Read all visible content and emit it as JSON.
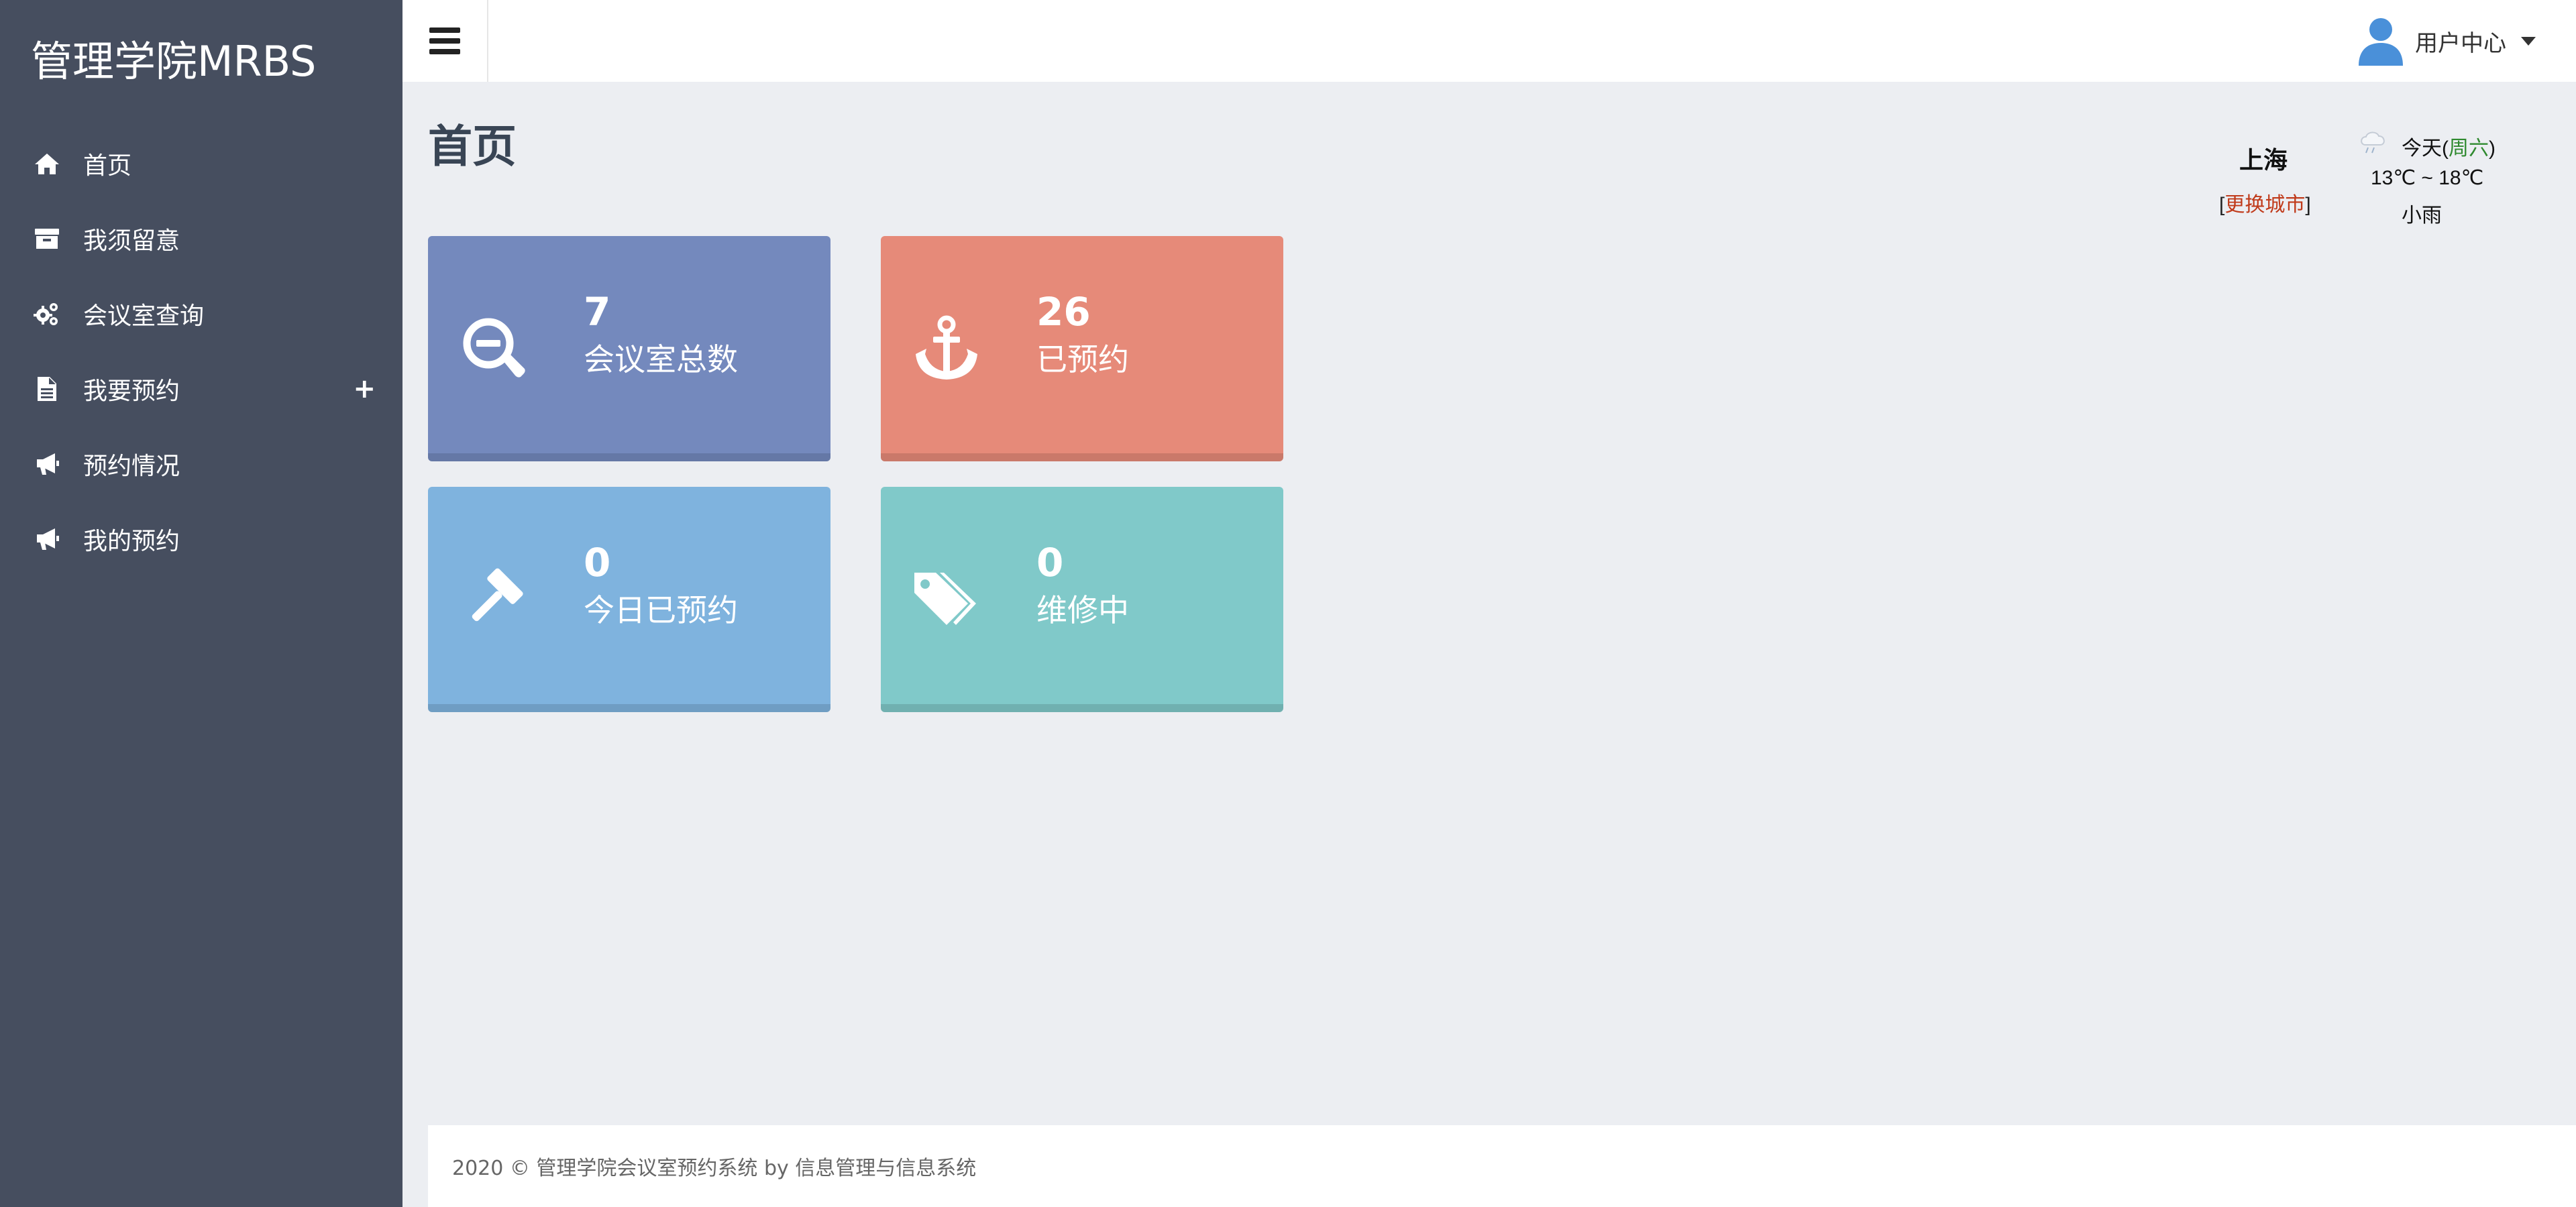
{
  "sidebar": {
    "brand": "管理学院MRBS",
    "items": [
      {
        "label": "首页",
        "icon": "home-icon"
      },
      {
        "label": "我须留意",
        "icon": "archive-icon"
      },
      {
        "label": "会议室查询",
        "icon": "gears-icon"
      },
      {
        "label": "我要预约",
        "icon": "file-icon",
        "expand": "+"
      },
      {
        "label": "预约情况",
        "icon": "bullhorn-icon"
      },
      {
        "label": "我的预约",
        "icon": "bullhorn-icon"
      }
    ],
    "background": "#464e5f"
  },
  "header": {
    "user_menu_label": "用户中心",
    "user_icon_color": "#4a90d9"
  },
  "main": {
    "page_title": "首页",
    "weather": {
      "city": "上海",
      "change_city_open": "[",
      "change_city_link": "更换城市",
      "change_city_close": "]",
      "today_prefix": "今天(",
      "weekday": "周六",
      "today_suffix": ")",
      "temperature": "13℃ ~ 18℃",
      "description": "小雨",
      "icon": "light-rain-icon"
    },
    "cards": [
      {
        "value": "7",
        "label": "会议室总数",
        "icon": "zoom-out-icon",
        "color": "#7489bd"
      },
      {
        "value": "26",
        "label": "已预约",
        "icon": "anchor-icon",
        "color": "#e68a79"
      },
      {
        "value": "0",
        "label": "今日已预约",
        "icon": "gavel-icon",
        "color": "#7fb3de"
      },
      {
        "value": "0",
        "label": "维修中",
        "icon": "tags-icon",
        "color": "#80c9c9"
      }
    ]
  },
  "footer": {
    "text": "2020 © 管理学院会议室预约系统 by 信息管理与信息系统"
  }
}
